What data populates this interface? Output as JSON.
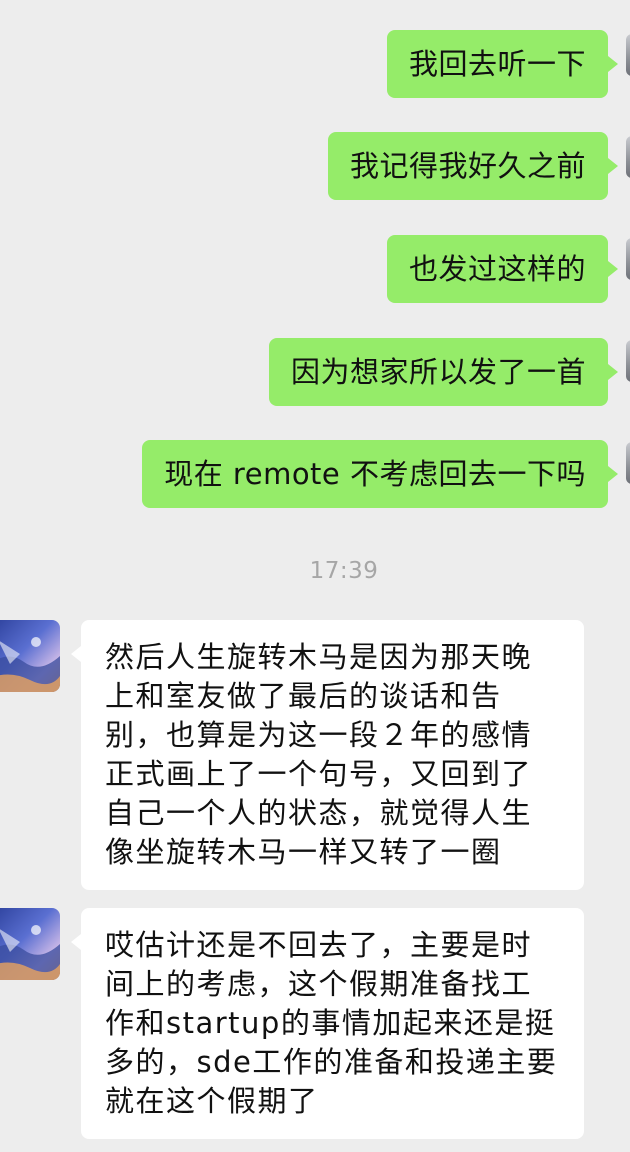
{
  "messages_out": [
    {
      "text": "我回去听一下"
    },
    {
      "text": "我记得我好久之前"
    },
    {
      "text": "也发过这样的"
    },
    {
      "text": "因为想家所以发了一首"
    },
    {
      "text": "现在 remote 不考虑回去一下吗"
    }
  ],
  "timestamp": "17:39",
  "messages_in": [
    {
      "text": "然后人生旋转木马是因为那天晚上和室友做了最后的谈话和告别，也算是为这一段２年的感情正式画上了一个句号，又回到了自己一个人的状态，就觉得人生像坐旋转木马一样又转了一圈"
    },
    {
      "text": "哎估计还是不回去了，主要是时间上的考虑，这个假期准备找工作和startup的事情加起来还是挺多的，sde工作的准备和投递主要就在这个假期了"
    }
  ],
  "colors": {
    "background": "#ededed",
    "outgoing_bubble": "#95ec69",
    "incoming_bubble": "#ffffff",
    "timestamp_text": "#a6a6a6"
  },
  "icons": {
    "contact_avatar": "avatar-icon",
    "my_avatar": "avatar-icon"
  }
}
